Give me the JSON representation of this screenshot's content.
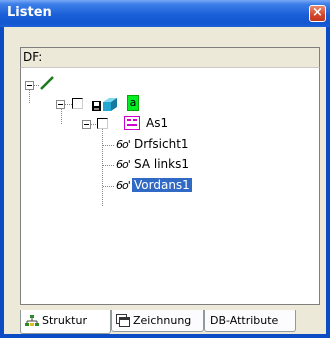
{
  "window": {
    "title": "Listen",
    "close_glyph": "×"
  },
  "df_label": "DF:",
  "tree": {
    "green_badge": "a",
    "as1": "As1",
    "drfsicht": "Drfsicht1",
    "sa_links": "SA links1",
    "vordans": "Vordans1",
    "glasses_glyph": "6o'"
  },
  "tabs": [
    {
      "label": "Struktur"
    },
    {
      "label": "Zeichnung"
    },
    {
      "label": "DB-Attribute"
    }
  ],
  "colors": {
    "title_bar": "#1a5fd8",
    "selection": "#316ac5",
    "green": "#00ee22"
  }
}
